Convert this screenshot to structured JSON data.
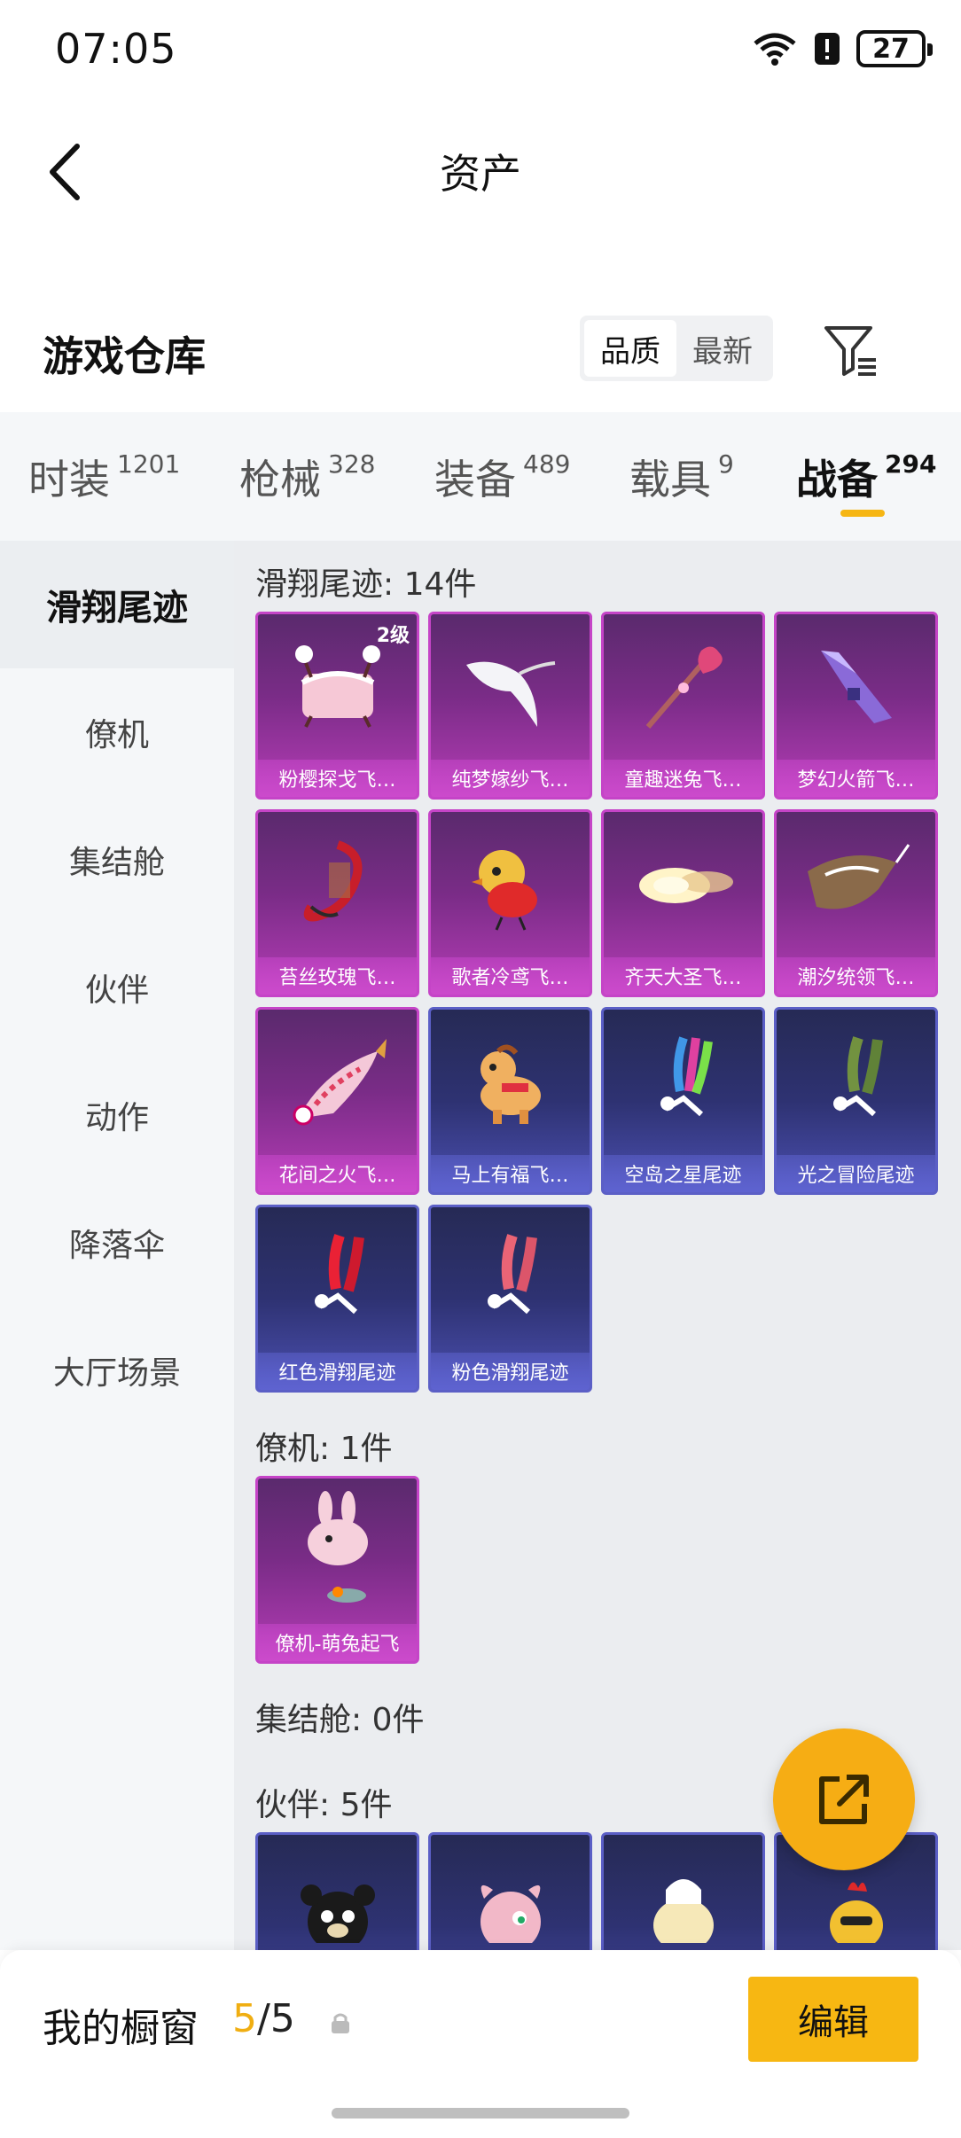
{
  "status_bar": {
    "time": "07:05",
    "battery": "27"
  },
  "nav": {
    "title": "资产"
  },
  "warehouse": {
    "title": "游戏仓库",
    "sort_options": [
      "品质",
      "最新"
    ],
    "active_sort": "品质"
  },
  "categories": [
    {
      "label": "时装",
      "count": "1201"
    },
    {
      "label": "枪械",
      "count": "328"
    },
    {
      "label": "装备",
      "count": "489"
    },
    {
      "label": "载具",
      "count": "9"
    },
    {
      "label": "战备",
      "count": "294"
    }
  ],
  "active_category": "战备",
  "sidebar": [
    {
      "label": "滑翔尾迹"
    },
    {
      "label": "僚机"
    },
    {
      "label": "集结舱"
    },
    {
      "label": "伙伴"
    },
    {
      "label": "动作"
    },
    {
      "label": "降落伞"
    },
    {
      "label": "大厅场景"
    }
  ],
  "sections": [
    {
      "title": "滑翔尾迹: 14件",
      "items": [
        {
          "name": "粉樱探戈飞…",
          "level": "2级",
          "style": "pink",
          "art": "basket"
        },
        {
          "name": "纯梦嫁纱飞…",
          "style": "pink",
          "art": "veil"
        },
        {
          "name": "童趣迷兔飞…",
          "style": "pink",
          "art": "wand"
        },
        {
          "name": "梦幻火箭飞…",
          "style": "pink",
          "art": "rocket"
        },
        {
          "name": "苔丝玫瑰飞…",
          "style": "pink",
          "art": "rose"
        },
        {
          "name": "歌者冷鸢飞…",
          "style": "pink",
          "art": "bird"
        },
        {
          "name": "齐天大圣飞…",
          "style": "pink",
          "art": "cloud"
        },
        {
          "name": "潮汐统领飞…",
          "style": "pink",
          "art": "ray"
        },
        {
          "name": "花间之火飞…",
          "style": "pink",
          "art": "koi"
        },
        {
          "name": "马上有福飞…",
          "style": "blue",
          "art": "horse"
        },
        {
          "name": "空岛之星尾迹",
          "style": "blue",
          "art": "smoke-rainbow"
        },
        {
          "name": "光之冒险尾迹",
          "style": "blue",
          "art": "smoke-green"
        },
        {
          "name": "红色滑翔尾迹",
          "style": "blue",
          "art": "smoke-red"
        },
        {
          "name": "粉色滑翔尾迹",
          "style": "blue",
          "art": "smoke-pink"
        }
      ]
    },
    {
      "title": "僚机: 1件",
      "items": [
        {
          "name": "僚机-萌兔起飞",
          "style": "pink",
          "art": "bunny"
        }
      ]
    },
    {
      "title": "集结舱: 0件",
      "items": []
    },
    {
      "title": "伙伴: 5件",
      "items": [
        {
          "name": "",
          "style": "blue",
          "art": "bear"
        },
        {
          "name": "",
          "style": "blue",
          "art": "pinkpet"
        },
        {
          "name": "",
          "style": "blue",
          "art": "chick"
        },
        {
          "name": "",
          "style": "blue",
          "art": "rooster"
        }
      ]
    }
  ],
  "bottom": {
    "showcase_label": "我的橱窗",
    "showcase_current": "5",
    "showcase_total": "/5",
    "edit_label": "编辑"
  },
  "colors": {
    "accent": "#f6b614",
    "pink_card": "#b43cb5",
    "blue_card": "#4b4fb0"
  }
}
